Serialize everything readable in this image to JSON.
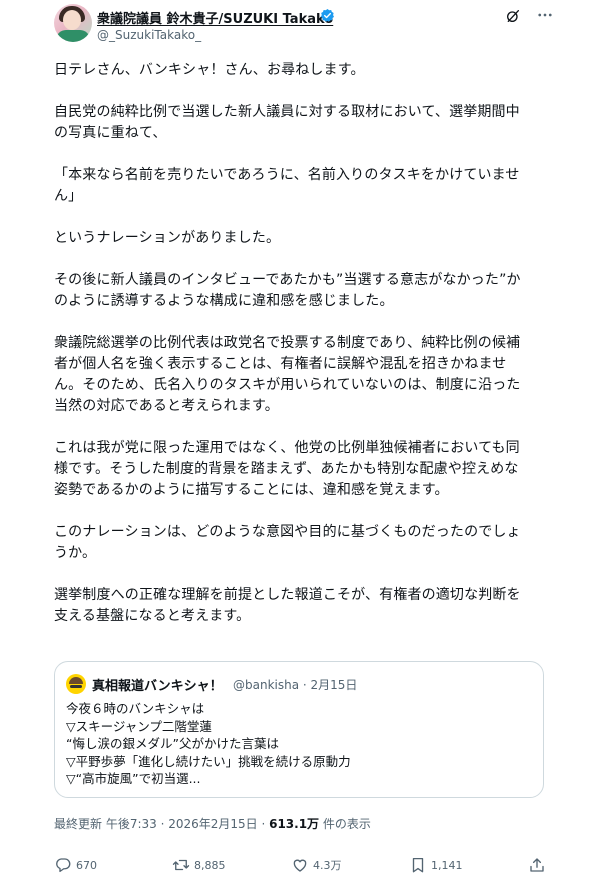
{
  "author": {
    "name": "衆議院議員 鈴木貴子/SUZUKI Takako",
    "handle": "@_SuzukiTakako_",
    "verified_color": "#1d9bf0"
  },
  "post": {
    "paragraphs": [
      "日テレさん、バンキシャ！さん、お尋ねします。",
      "自民党の純粋比例で当選した新人議員に対する取材において、選挙期間中\nの写真に重ねて、",
      "「本来なら名前を売りたいであろうに、名前入りのタスキをかけていませ\nん」",
      "というナレーションがありました。",
      "その後に新人議員のインタビューであたかも”当選する意志がなかった”か\nのように誘導するような構成に違和感を感じました。",
      "衆議院総選挙の比例代表は政党名で投票する制度であり、純粋比例の候補\n者が個人名を強く表示することは、有権者に誤解や混乱を招きかねませ\nん。そのため、氏名入りのタスキが用いられていないのは、制度に沿った\n当然の対応であると考えられます。",
      "これは我が党に限った運用ではなく、他党の比例単独候補者においても同\n様です。そうした制度的背景を踏まえず、あたかも特別な配慮や控えめな\n姿勢であるかのように描写することには、違和感を覚えます。",
      "このナレーションは、どのような意図や目的に基づくものだったのでしょ\nうか。",
      "選挙制度への正確な理解を前提とした報道こそが、有権者の適切な判断を\n支える基盤になると考えます。"
    ]
  },
  "quote": {
    "name": "真相報道バンキシャ！",
    "meta": "@bankisha · 2月15日",
    "lines": [
      "今夜６時のバンキシャは",
      "▽スキージャンプ二階堂蓮",
      "“悔し涙の銀メダル”父がかけた言葉は",
      "▽平野歩夢「進化し続けたい」挑戦を続ける原動力",
      "▽“高市旋風”で初当選..."
    ]
  },
  "timeline": {
    "prefix": "最終更新 午後7:33 · 2026年2月15日 · ",
    "views": "613.1万",
    "suffix": " 件の表示"
  },
  "actions": {
    "replies": "670",
    "reposts": "8,885",
    "likes": "4.3万",
    "bookmarks": "1,141"
  },
  "icons": [
    "verified-badge-icon",
    "grok-icon",
    "more-icon",
    "reply-icon",
    "repost-icon",
    "like-icon",
    "bookmark-icon",
    "share-icon"
  ]
}
